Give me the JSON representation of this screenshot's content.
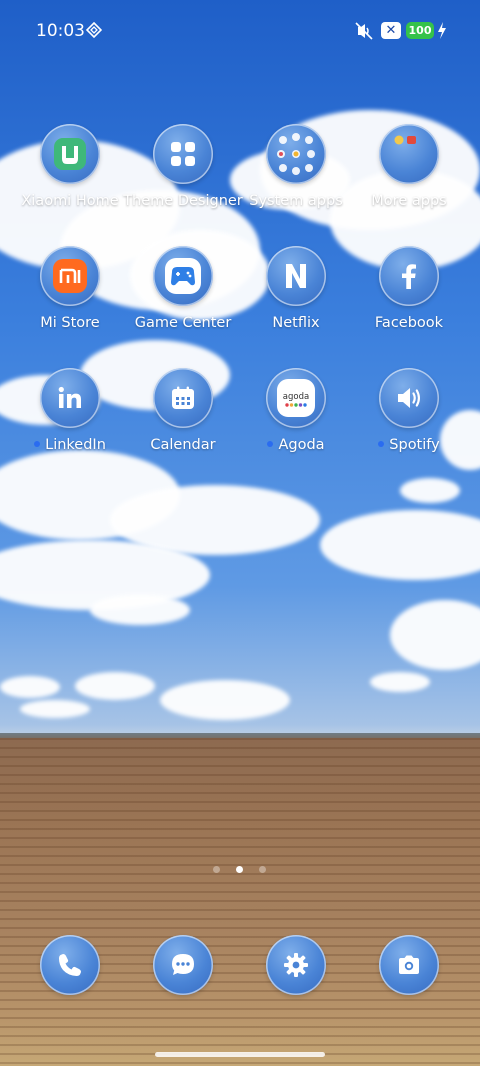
{
  "status_bar": {
    "time": "10:03",
    "battery_level": "100",
    "icons": [
      "vpn-icon",
      "silent-mode-icon",
      "x-notification-icon",
      "battery-icon",
      "charging-icon"
    ],
    "battery_color": "#35c24a"
  },
  "apps": [
    {
      "label": "Xiaomi Home",
      "icon": "xiaomi-home-icon"
    },
    {
      "label": "Theme Designer",
      "icon": "grid-icon"
    },
    {
      "label": "System apps",
      "icon": "folder-icon"
    },
    {
      "label": "More apps",
      "icon": "folder-icon"
    },
    {
      "label": "Mi Store",
      "icon": "mi-store-icon"
    },
    {
      "label": "Game Center",
      "icon": "gamepad-icon"
    },
    {
      "label": "Netflix",
      "icon": "netflix-icon"
    },
    {
      "label": "Facebook",
      "icon": "facebook-icon"
    },
    {
      "label": "LinkedIn",
      "icon": "linkedin-icon",
      "new_dot": true
    },
    {
      "label": "Calendar",
      "icon": "calendar-icon"
    },
    {
      "label": "Agoda",
      "icon": "agoda-icon",
      "new_dot": true,
      "logo_text": "agoda"
    },
    {
      "label": "Spotify",
      "icon": "speaker-icon",
      "new_dot": true
    }
  ],
  "dock": [
    {
      "name": "phone",
      "icon": "phone-icon"
    },
    {
      "name": "messages",
      "icon": "chat-icon"
    },
    {
      "name": "settings",
      "icon": "gear-icon"
    },
    {
      "name": "camera",
      "icon": "camera-icon"
    }
  ],
  "page_indicator": {
    "pages": 3,
    "current": 2
  },
  "colors": {
    "icon_blue": "#4a84d6",
    "notification_dot": "#2a6cf0"
  }
}
